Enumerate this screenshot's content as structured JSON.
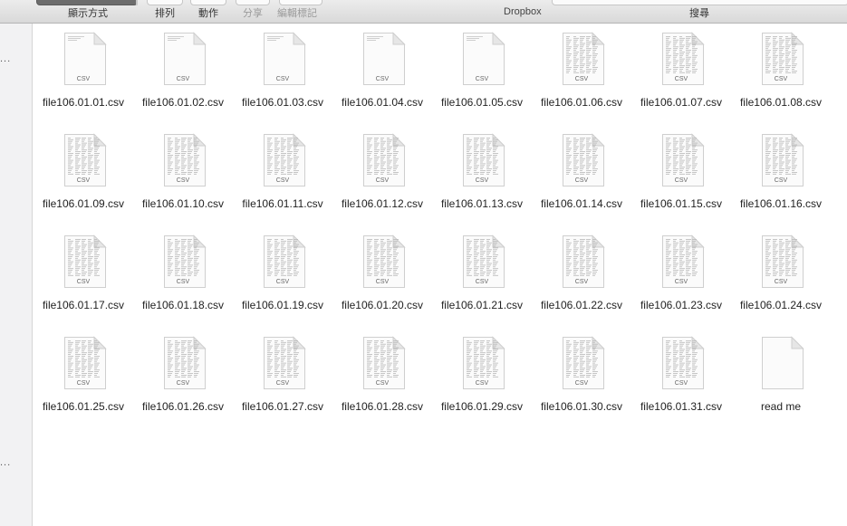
{
  "toolbar": {
    "view_label": "顯示方式",
    "arrange_label": "排列",
    "action_label": "動作",
    "share_label": "分享",
    "tags_label": "編輯標記",
    "window_title": "Dropbox",
    "search_label": "搜尋"
  },
  "sidebar": {
    "more_label": "..."
  },
  "files": [
    {
      "name": "file106.01.01.csv",
      "type_label": "CSV",
      "preview": false
    },
    {
      "name": "file106.01.02.csv",
      "type_label": "CSV",
      "preview": false
    },
    {
      "name": "file106.01.03.csv",
      "type_label": "CSV",
      "preview": false
    },
    {
      "name": "file106.01.04.csv",
      "type_label": "CSV",
      "preview": false
    },
    {
      "name": "file106.01.05.csv",
      "type_label": "CSV",
      "preview": false
    },
    {
      "name": "file106.01.06.csv",
      "type_label": "CSV",
      "preview": true
    },
    {
      "name": "file106.01.07.csv",
      "type_label": "CSV",
      "preview": true
    },
    {
      "name": "file106.01.08.csv",
      "type_label": "CSV",
      "preview": true
    },
    {
      "name": "file106.01.09.csv",
      "type_label": "CSV",
      "preview": true
    },
    {
      "name": "file106.01.10.csv",
      "type_label": "CSV",
      "preview": true
    },
    {
      "name": "file106.01.11.csv",
      "type_label": "CSV",
      "preview": true
    },
    {
      "name": "file106.01.12.csv",
      "type_label": "CSV",
      "preview": true
    },
    {
      "name": "file106.01.13.csv",
      "type_label": "CSV",
      "preview": true
    },
    {
      "name": "file106.01.14.csv",
      "type_label": "CSV",
      "preview": true
    },
    {
      "name": "file106.01.15.csv",
      "type_label": "CSV",
      "preview": true
    },
    {
      "name": "file106.01.16.csv",
      "type_label": "CSV",
      "preview": true
    },
    {
      "name": "file106.01.17.csv",
      "type_label": "CSV",
      "preview": true
    },
    {
      "name": "file106.01.18.csv",
      "type_label": "CSV",
      "preview": true
    },
    {
      "name": "file106.01.19.csv",
      "type_label": "CSV",
      "preview": true
    },
    {
      "name": "file106.01.20.csv",
      "type_label": "CSV",
      "preview": true
    },
    {
      "name": "file106.01.21.csv",
      "type_label": "CSV",
      "preview": true
    },
    {
      "name": "file106.01.22.csv",
      "type_label": "CSV",
      "preview": true
    },
    {
      "name": "file106.01.23.csv",
      "type_label": "CSV",
      "preview": true
    },
    {
      "name": "file106.01.24.csv",
      "type_label": "CSV",
      "preview": true
    },
    {
      "name": "file106.01.25.csv",
      "type_label": "CSV",
      "preview": true
    },
    {
      "name": "file106.01.26.csv",
      "type_label": "CSV",
      "preview": true
    },
    {
      "name": "file106.01.27.csv",
      "type_label": "CSV",
      "preview": true
    },
    {
      "name": "file106.01.28.csv",
      "type_label": "CSV",
      "preview": true
    },
    {
      "name": "file106.01.29.csv",
      "type_label": "CSV",
      "preview": true
    },
    {
      "name": "file106.01.30.csv",
      "type_label": "CSV",
      "preview": true
    },
    {
      "name": "file106.01.31.csv",
      "type_label": "CSV",
      "preview": true
    },
    {
      "name": "read me",
      "type_label": "",
      "preview": false
    }
  ],
  "colors": {
    "toolbar_bg": "#e2e2e2",
    "sidebar_bg": "#f2f2f3",
    "text": "#222222"
  }
}
